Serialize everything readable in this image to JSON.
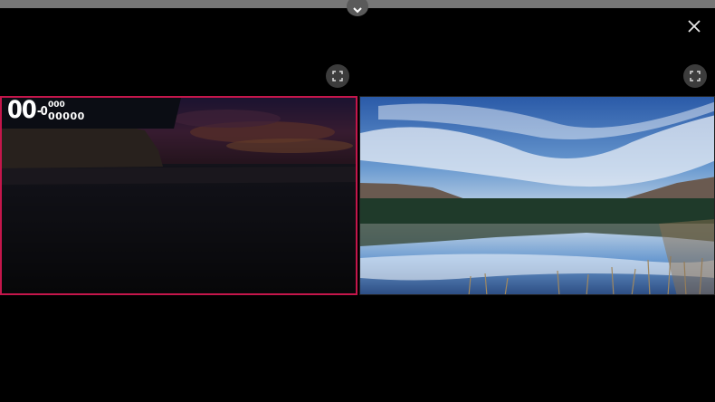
{
  "top_bar": {
    "collapse_icon": "chevron-down-icon"
  },
  "controls": {
    "close_icon": "close-icon",
    "fullscreen_icon": "fullscreen-icon"
  },
  "score_overlay": {
    "main": "00",
    "main_sup": "-0",
    "line1": "000",
    "line2": "00000"
  },
  "colors": {
    "selected_frame": "#c4164b",
    "background": "#000000"
  }
}
